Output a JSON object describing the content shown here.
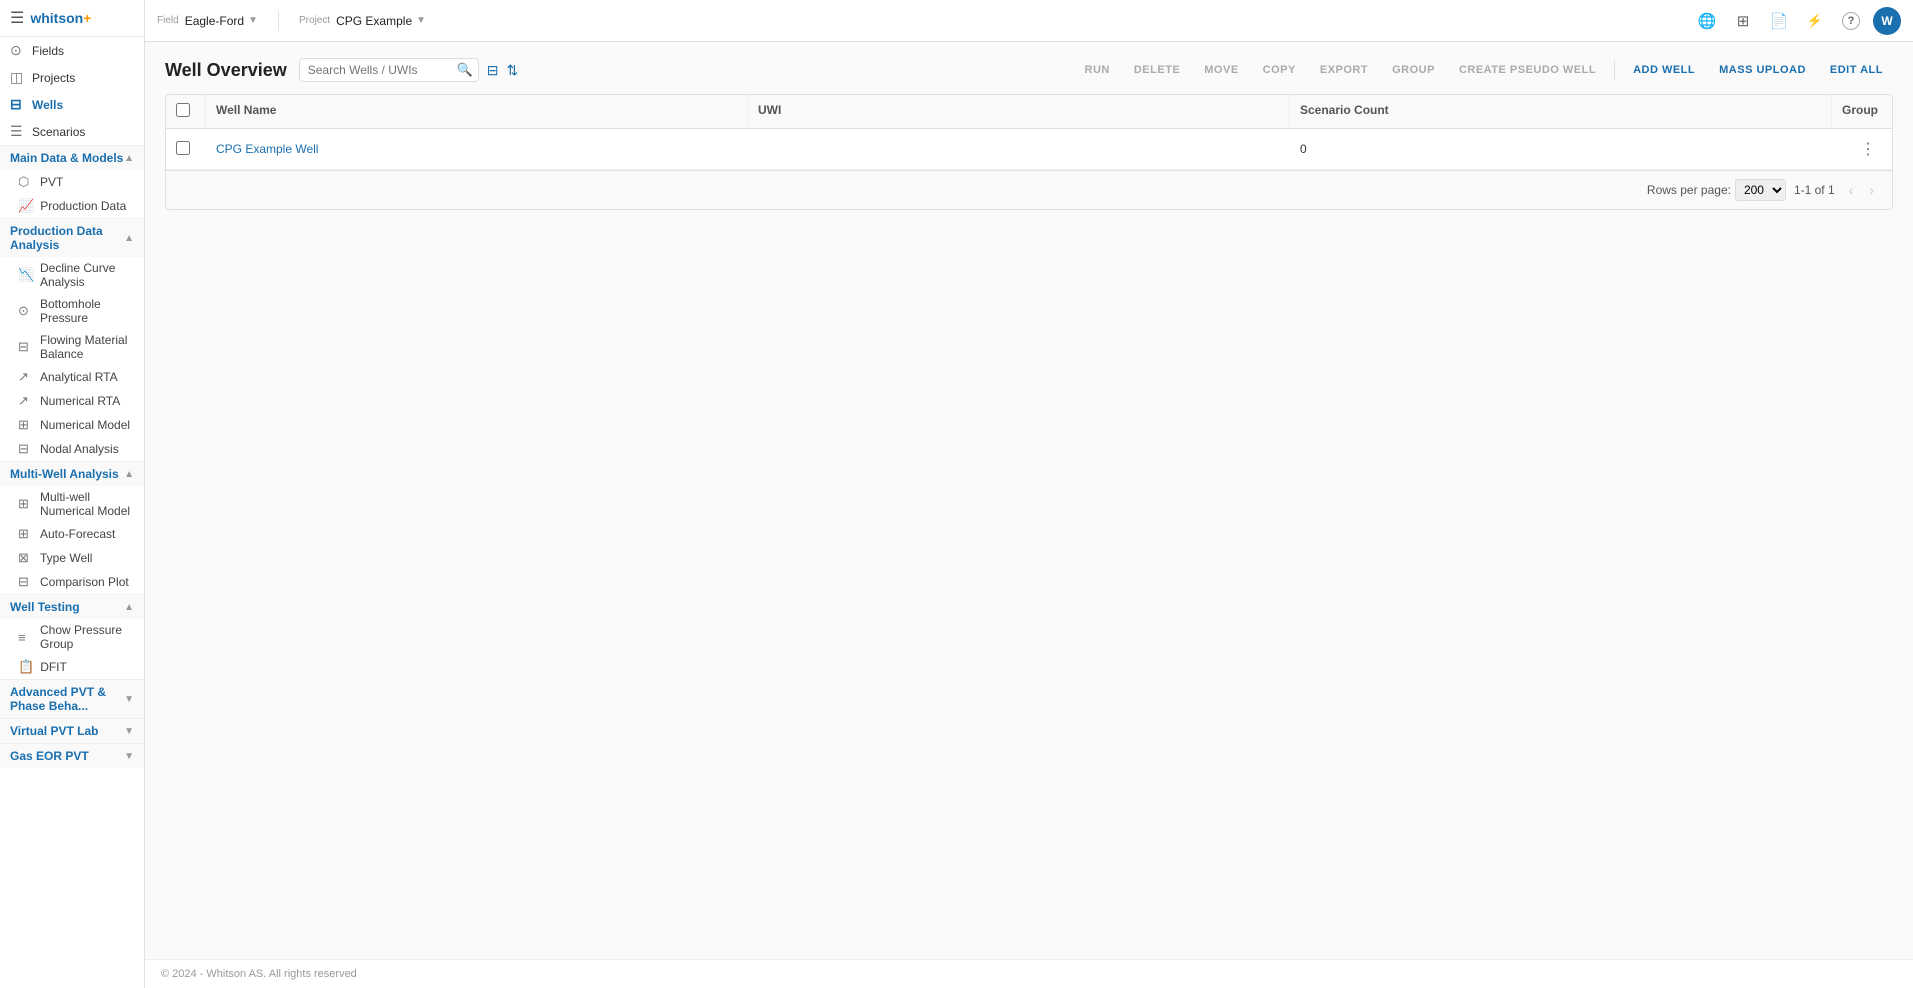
{
  "app": {
    "brand": "whitson",
    "brand_suffix": "+",
    "hamburger": "☰"
  },
  "field_selector": {
    "label": "Field",
    "value": "Eagle-Ford",
    "arrow": "▼"
  },
  "project_selector": {
    "label": "Project",
    "value": "CPG Example",
    "arrow": "▼"
  },
  "top_bar_icons": {
    "globe": "🌐",
    "grid": "⊞",
    "file": "📄",
    "filter": "⚡",
    "help": "?",
    "avatar_initials": "W"
  },
  "sidebar": {
    "sections": [
      {
        "name": "top-links",
        "items": [
          {
            "id": "fields",
            "label": "Fields",
            "icon": "⊙"
          },
          {
            "id": "projects",
            "label": "Projects",
            "icon": "◫"
          },
          {
            "id": "wells",
            "label": "Wells",
            "icon": "⊟",
            "active": true
          },
          {
            "id": "scenarios",
            "label": "Scenarios",
            "icon": "☰"
          }
        ]
      },
      {
        "name": "Main Data & Models",
        "collapsible": true,
        "open": true,
        "items": [
          {
            "id": "pvt",
            "label": "PVT",
            "icon": "⬡"
          },
          {
            "id": "production-data",
            "label": "Production Data",
            "icon": "📈"
          }
        ]
      },
      {
        "name": "Production Data Analysis",
        "collapsible": true,
        "open": true,
        "items": [
          {
            "id": "decline-curve",
            "label": "Decline Curve Analysis",
            "icon": "📉"
          },
          {
            "id": "bottomhole",
            "label": "Bottomhole Pressure",
            "icon": "⊙"
          },
          {
            "id": "flowing-material",
            "label": "Flowing Material Balance",
            "icon": "⊟"
          },
          {
            "id": "analytical-rta",
            "label": "Analytical RTA",
            "icon": "↗"
          },
          {
            "id": "numerical-rta",
            "label": "Numerical RTA",
            "icon": "↗"
          },
          {
            "id": "numerical-model",
            "label": "Numerical Model",
            "icon": "⊞"
          },
          {
            "id": "nodal",
            "label": "Nodal Analysis",
            "icon": "⊟"
          }
        ]
      },
      {
        "name": "Multi-Well Analysis",
        "collapsible": true,
        "open": true,
        "items": [
          {
            "id": "multi-well-numerical",
            "label": "Multi-well Numerical Model",
            "icon": "⊞"
          },
          {
            "id": "auto-forecast",
            "label": "Auto-Forecast",
            "icon": "⊞"
          },
          {
            "id": "type-well",
            "label": "Type Well",
            "icon": "⊠"
          },
          {
            "id": "comparison-plot",
            "label": "Comparison Plot",
            "icon": "⊟"
          }
        ]
      },
      {
        "name": "Well Testing",
        "collapsible": true,
        "open": true,
        "items": [
          {
            "id": "chow-pressure",
            "label": "Chow Pressure Group",
            "icon": "≡"
          },
          {
            "id": "dfit",
            "label": "DFIT",
            "icon": "📋"
          }
        ]
      },
      {
        "name": "Advanced PVT & Phase Beha...",
        "collapsible": true,
        "open": false,
        "items": []
      },
      {
        "name": "Virtual PVT Lab",
        "collapsible": true,
        "open": false,
        "items": []
      },
      {
        "name": "Gas EOR PVT",
        "collapsible": true,
        "open": false,
        "items": []
      }
    ]
  },
  "page": {
    "title": "Well Overview"
  },
  "search": {
    "placeholder": "Search Wells / UWIs"
  },
  "toolbar": {
    "run_label": "RUN",
    "delete_label": "DELETE",
    "move_label": "MOVE",
    "copy_label": "COPY",
    "export_label": "EXPORT",
    "group_label": "GROUP",
    "create_pseudo_label": "CREATE PSEUDO WELL",
    "add_well_label": "ADD WELL",
    "mass_upload_label": "MASS UPLOAD",
    "edit_all_label": "EDIT ALL"
  },
  "table": {
    "columns": [
      {
        "id": "checkbox",
        "label": ""
      },
      {
        "id": "well-name",
        "label": "Well Name"
      },
      {
        "id": "uwi",
        "label": "UWI"
      },
      {
        "id": "scenario-count",
        "label": "Scenario Count"
      },
      {
        "id": "group",
        "label": "Group"
      }
    ],
    "rows": [
      {
        "checkbox": false,
        "well_name": "CPG Example Well",
        "uwi": "",
        "scenario_count": "0",
        "group": ""
      }
    ]
  },
  "pagination": {
    "rows_per_page_label": "Rows per page:",
    "rows_per_page_value": "200",
    "page_info": "1-1 of 1"
  },
  "footer": {
    "copyright": "© 2024 - Whitson AS. All rights reserved"
  }
}
